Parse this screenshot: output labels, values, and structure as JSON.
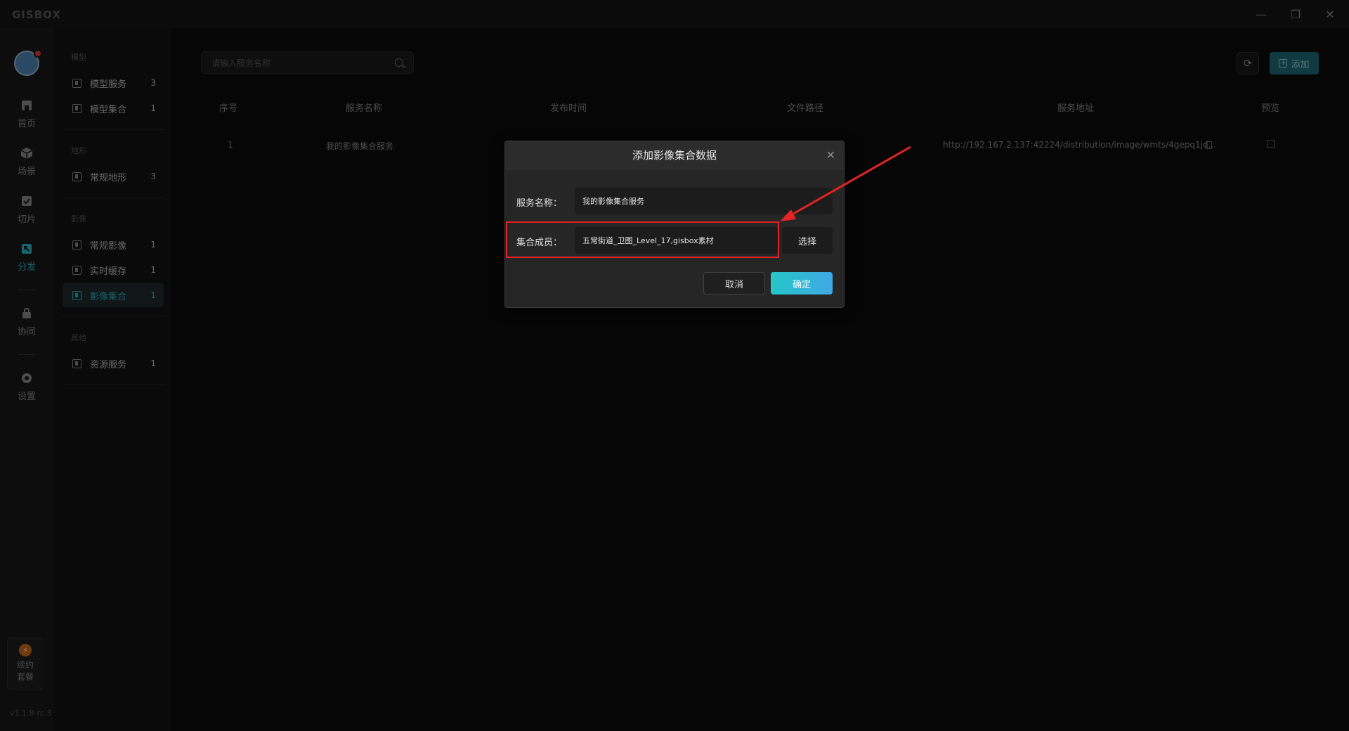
{
  "app": {
    "logo": "GISBOX"
  },
  "window": {
    "minimize": "—",
    "restore": "❐",
    "close": "✕"
  },
  "rail": {
    "items": [
      {
        "label": "首页",
        "icon": "home-icon"
      },
      {
        "label": "场景",
        "icon": "cube-icon"
      },
      {
        "label": "切片",
        "icon": "slice-icon"
      },
      {
        "label": "分发",
        "icon": "distribute-icon"
      },
      {
        "label": "协同",
        "icon": "lock-icon"
      },
      {
        "label": "设置",
        "icon": "gear-icon"
      }
    ],
    "plan": {
      "icon": "⚡",
      "line1": "续约",
      "line2": "套餐"
    },
    "version": "v1.1.8-rc.3"
  },
  "sidebar": {
    "groups": [
      {
        "title": "模型",
        "items": [
          {
            "label": "模型服务",
            "count": "3"
          },
          {
            "label": "模型集合",
            "count": "1"
          }
        ]
      },
      {
        "title": "地形",
        "items": [
          {
            "label": "常规地形",
            "count": "3"
          }
        ]
      },
      {
        "title": "影像",
        "items": [
          {
            "label": "常规影像",
            "count": "1"
          },
          {
            "label": "实时缓存",
            "count": "1"
          },
          {
            "label": "影像集合",
            "count": "1"
          }
        ]
      },
      {
        "title": "其他",
        "items": [
          {
            "label": "资源服务",
            "count": "1"
          }
        ]
      }
    ]
  },
  "toolbar": {
    "search_placeholder": "请输入服务名称",
    "refresh_icon": "⟳",
    "add_label": "添加"
  },
  "table": {
    "headers": [
      "序号",
      "服务名称",
      "发布时间",
      "文件路径",
      "服务地址",
      "预览"
    ],
    "rows": [
      {
        "index": "1",
        "name": "我的影像集合服务",
        "url": "http://192.167.2.137:42224/distribution/image/wmts/4gepq1jd..."
      }
    ]
  },
  "dialog": {
    "title": "添加影像集合数据",
    "close": "✕",
    "name_label": "服务名称：",
    "name_value": "我的影像集合服务",
    "members_label": "集合成员：",
    "members_value": "五常街道_卫图_Level_17,gisbox素材",
    "choose_label": "选择",
    "cancel_label": "取消",
    "ok_label": "确定"
  },
  "colors": {
    "accent": "#2bb6c9",
    "highlight": "#e02424"
  }
}
